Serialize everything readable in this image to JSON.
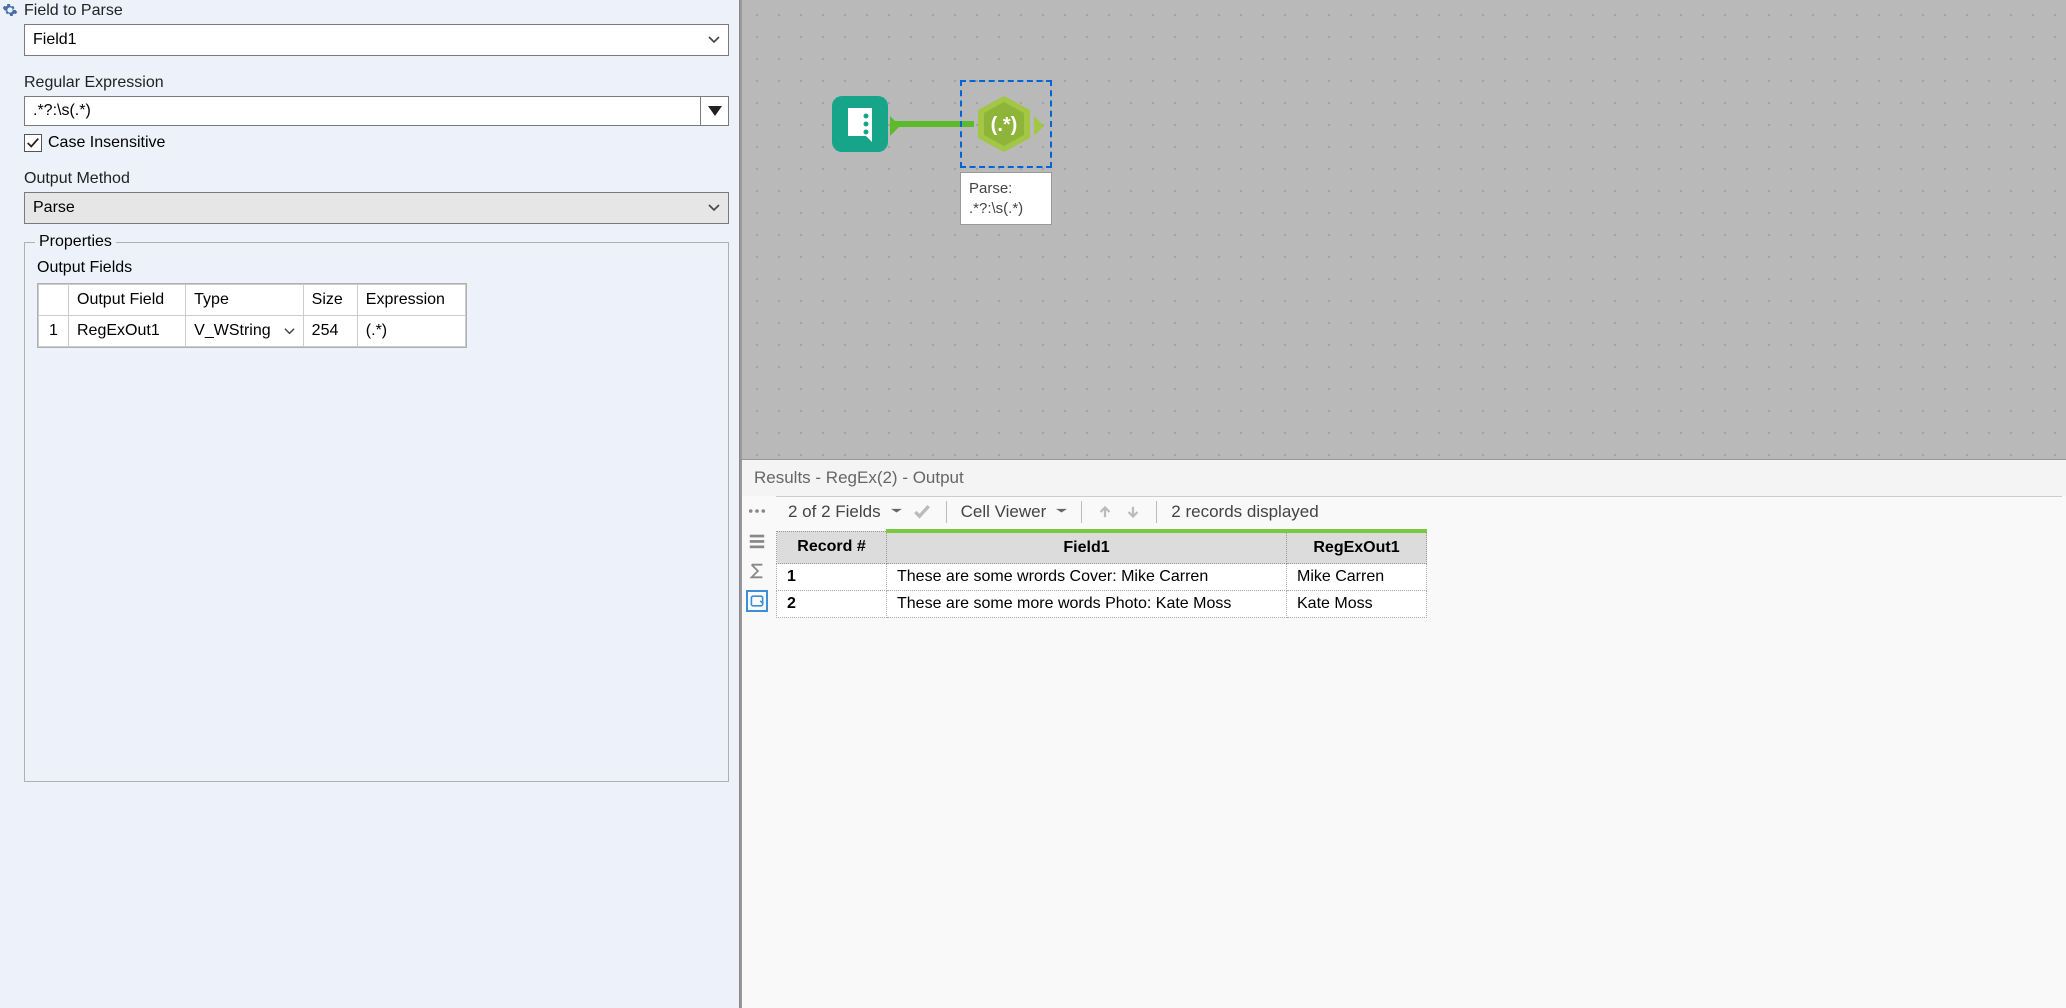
{
  "config": {
    "field_to_parse_label": "Field to Parse",
    "field_to_parse_value": "Field1",
    "regex_label": "Regular Expression",
    "regex_value": ".*?:\\s(.*)",
    "case_insensitive_label": "Case Insensitive",
    "case_insensitive_checked": true,
    "output_method_label": "Output Method",
    "output_method_value": "Parse",
    "properties_legend": "Properties",
    "output_fields_label": "Output Fields",
    "output_fields_headers": {
      "field": "Output Field",
      "type": "Type",
      "size": "Size",
      "expr": "Expression"
    },
    "output_fields_rows": [
      {
        "num": "1",
        "field": "RegExOut1",
        "type": "V_WString",
        "size": "254",
        "expr": "(.*)"
      }
    ]
  },
  "canvas": {
    "tooltip_line1": "Parse:",
    "tooltip_line2": ".*?:\\s(.*)",
    "regex_node_label": "(.*)"
  },
  "results": {
    "title": "Results - RegEx(2) - Output",
    "fields_text": "2 of 2 Fields",
    "cell_viewer_text": "Cell Viewer",
    "records_text": "2 records displayed",
    "headers": {
      "record": "Record #",
      "field1": "Field1",
      "regexout": "RegExOut1"
    },
    "rows": [
      {
        "num": "1",
        "field1": "These are some wrords Cover: Mike Carren",
        "regexout": "Mike Carren"
      },
      {
        "num": "2",
        "field1": "These are some more words Photo: Kate Moss",
        "regexout": "Kate Moss"
      }
    ]
  }
}
